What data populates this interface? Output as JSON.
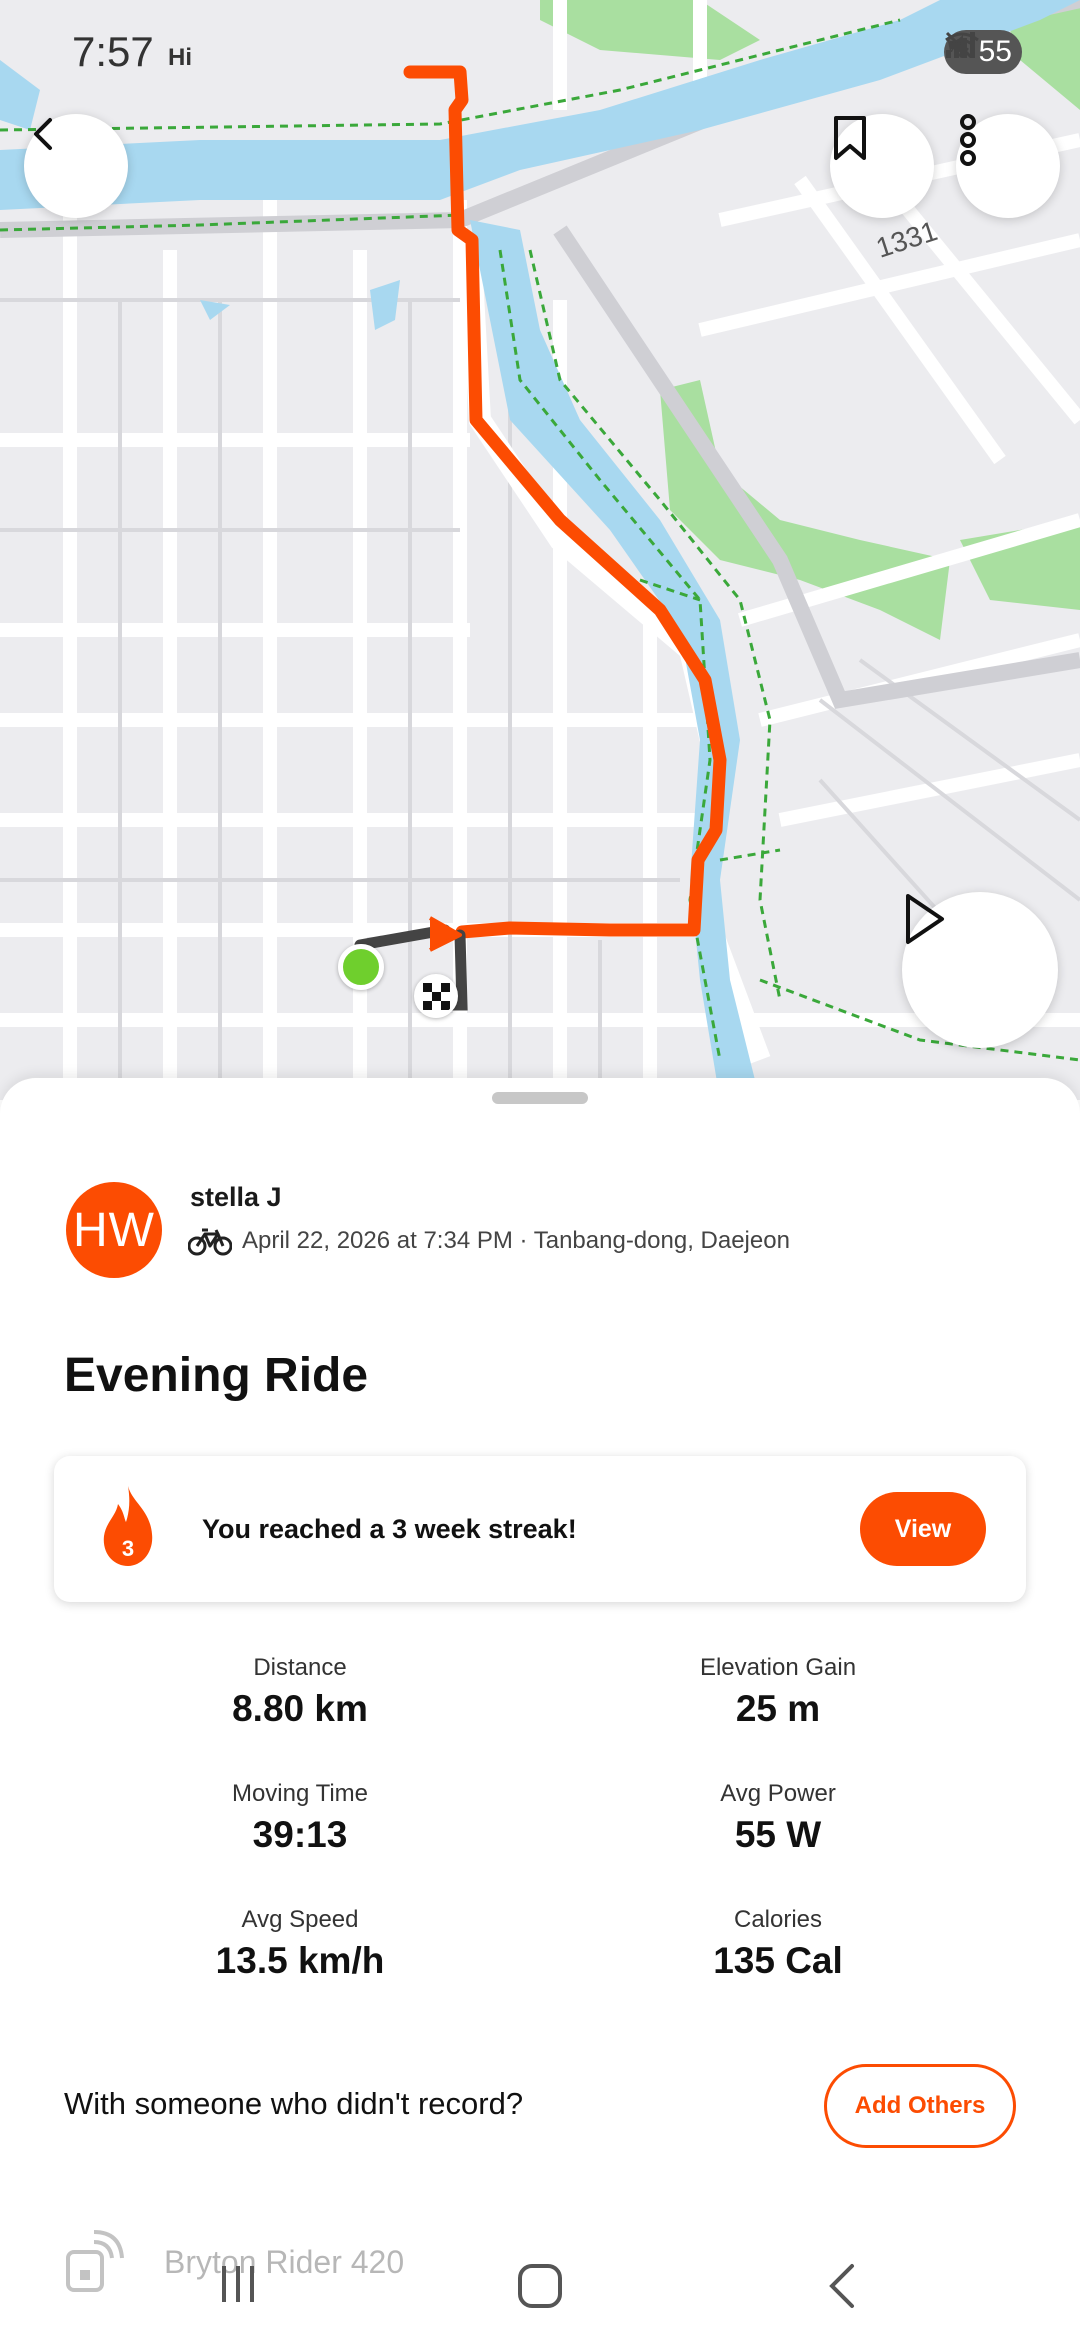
{
  "status_bar": {
    "time": "7:57",
    "hi_label": "Hi",
    "battery": "55"
  },
  "map": {
    "route_number_label": "1331"
  },
  "athlete": {
    "initials": "HW",
    "name": "stella J",
    "activity_meta": "April 22, 2026 at 7:34 PM · Tanbang-dong, Daejeon"
  },
  "activity": {
    "title": "Evening Ride"
  },
  "streak": {
    "count": "3",
    "message": "You reached a 3 week streak!",
    "button_label": "View"
  },
  "stats": [
    {
      "label": "Distance",
      "value": "8.80 km"
    },
    {
      "label": "Elevation Gain",
      "value": "25 m"
    },
    {
      "label": "Moving Time",
      "value": "39:13"
    },
    {
      "label": "Avg Power",
      "value": "55 W"
    },
    {
      "label": "Avg Speed",
      "value": "13.5 km/h"
    },
    {
      "label": "Calories",
      "value": "135 Cal"
    }
  ],
  "together": {
    "prompt": "With someone who didn't record?",
    "button_label": "Add Others"
  },
  "device": {
    "name": "Bryton Rider 420"
  },
  "colors": {
    "accent": "#fc4c02",
    "river": "#a8d8f0",
    "park": "#a9dfa0",
    "start_dot": "#6fcf2d"
  }
}
